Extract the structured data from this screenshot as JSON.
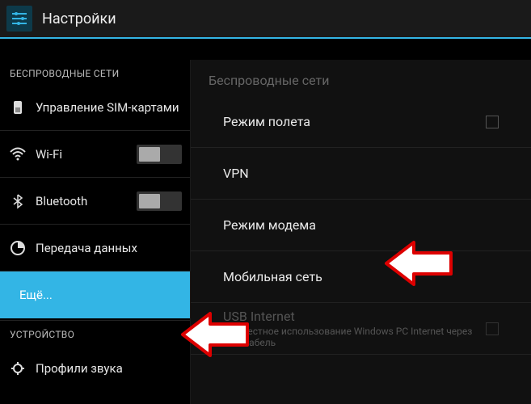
{
  "header": {
    "title": "Настройки"
  },
  "sidebar": {
    "section_wireless": "БЕСПРОВОДНЫЕ СЕТИ",
    "section_device": "УСТРОЙСТВО",
    "items": {
      "sim": "Управление SIM-картами",
      "wifi": "Wi-Fi",
      "bluetooth": "Bluetooth",
      "data": "Передача данных",
      "more": "Ещё...",
      "sound": "Профили звука"
    }
  },
  "content": {
    "header": "Беспроводные сети",
    "airplane": "Режим полета",
    "vpn": "VPN",
    "tether": "Режим модема",
    "mobile": "Мобильная сеть",
    "usb_title": "USB Internet",
    "usb_sub": "Совместное использование Windows PC Internet через USB-кабель"
  }
}
